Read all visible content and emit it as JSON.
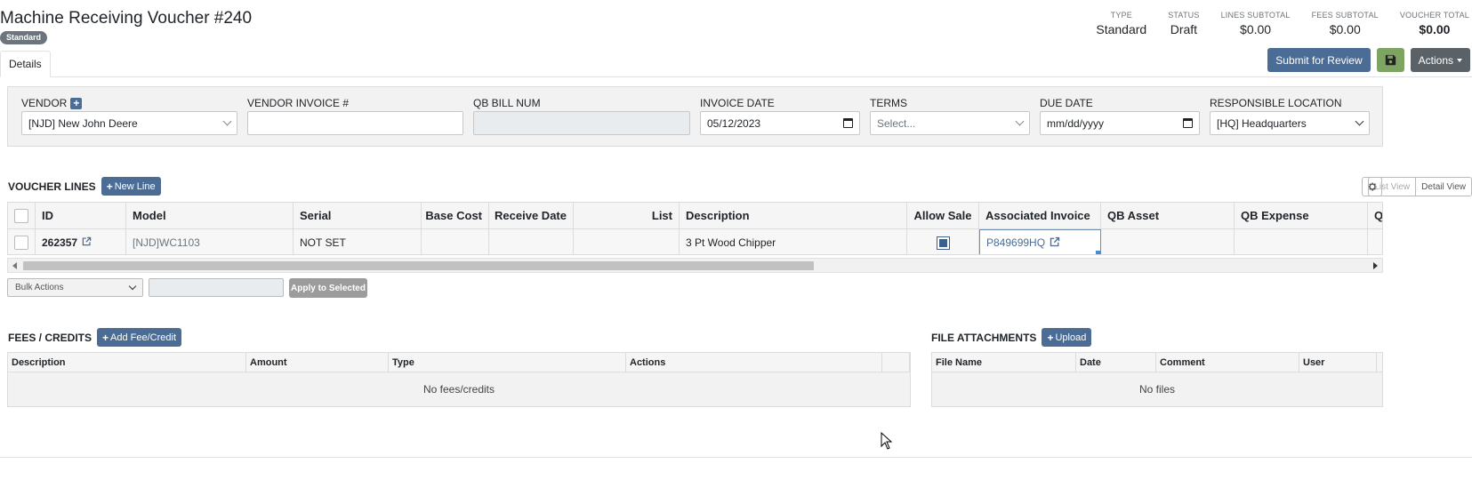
{
  "header": {
    "title": "Machine Receiving Voucher #240",
    "badge": "Standard"
  },
  "summary": [
    {
      "label": "TYPE",
      "value": "Standard"
    },
    {
      "label": "STATUS",
      "value": "Draft"
    },
    {
      "label": "LINES SUBTOTAL",
      "value": "$0.00"
    },
    {
      "label": "FEES SUBTOTAL",
      "value": "$0.00"
    },
    {
      "label": "VOUCHER TOTAL",
      "value": "$0.00"
    }
  ],
  "tabs": [
    {
      "label": "Details"
    }
  ],
  "toolbar": {
    "submit_label": "Submit for Review",
    "actions_label": "Actions"
  },
  "form": {
    "vendor": {
      "label": "VENDOR",
      "value": "[NJD] New John Deere"
    },
    "vendor_invoice": {
      "label": "VENDOR INVOICE #",
      "value": ""
    },
    "qb_bill": {
      "label": "QB BILL NUM",
      "value": ""
    },
    "invoice_date": {
      "label": "INVOICE DATE",
      "value": "05/12/2023"
    },
    "terms": {
      "label": "TERMS",
      "value": "Select..."
    },
    "due_date": {
      "label": "DUE DATE",
      "value": "mm/dd/yyyy"
    },
    "location": {
      "label": "RESPONSIBLE LOCATION",
      "value": "[HQ] Headquarters"
    }
  },
  "voucher_lines": {
    "title": "VOUCHER LINES",
    "new_line_label": "New Line",
    "list_view_label": "List View",
    "detail_view_label": "Detail View",
    "columns": [
      "ID",
      "Model",
      "Serial",
      "Base Cost",
      "Receive Date",
      "List",
      "Description",
      "Allow Sale",
      "Associated Invoice",
      "QB Asset",
      "QB Expense",
      "Q"
    ],
    "rows": [
      {
        "id": "262357",
        "model": "[NJD]WC1103",
        "serial": "NOT SET",
        "base_cost": "",
        "receive_date": "",
        "list": "",
        "description": "3 Pt Wood Chipper",
        "allow_sale": true,
        "associated_invoice": "P849699HQ",
        "qb_asset": "",
        "qb_expense": ""
      }
    ]
  },
  "bulk": {
    "select_label": "Bulk Actions",
    "apply_label": "Apply to Selected"
  },
  "fees": {
    "title": "FEES / CREDITS",
    "add_label": "Add Fee/Credit",
    "columns": [
      "Description",
      "Amount",
      "Type",
      "Actions"
    ],
    "empty": "No fees/credits"
  },
  "files": {
    "title": "FILE ATTACHMENTS",
    "upload_label": "Upload",
    "columns": [
      "File Name",
      "Date",
      "Comment",
      "User"
    ],
    "empty": "No files"
  },
  "colors": {
    "primary": "#4b6c94",
    "success": "#7da561",
    "secondary": "#5a6268"
  },
  "icons": [
    "plus-icon",
    "external-link-icon",
    "save-icon",
    "gear-icon",
    "calendar-icon",
    "chevron-down-icon"
  ]
}
